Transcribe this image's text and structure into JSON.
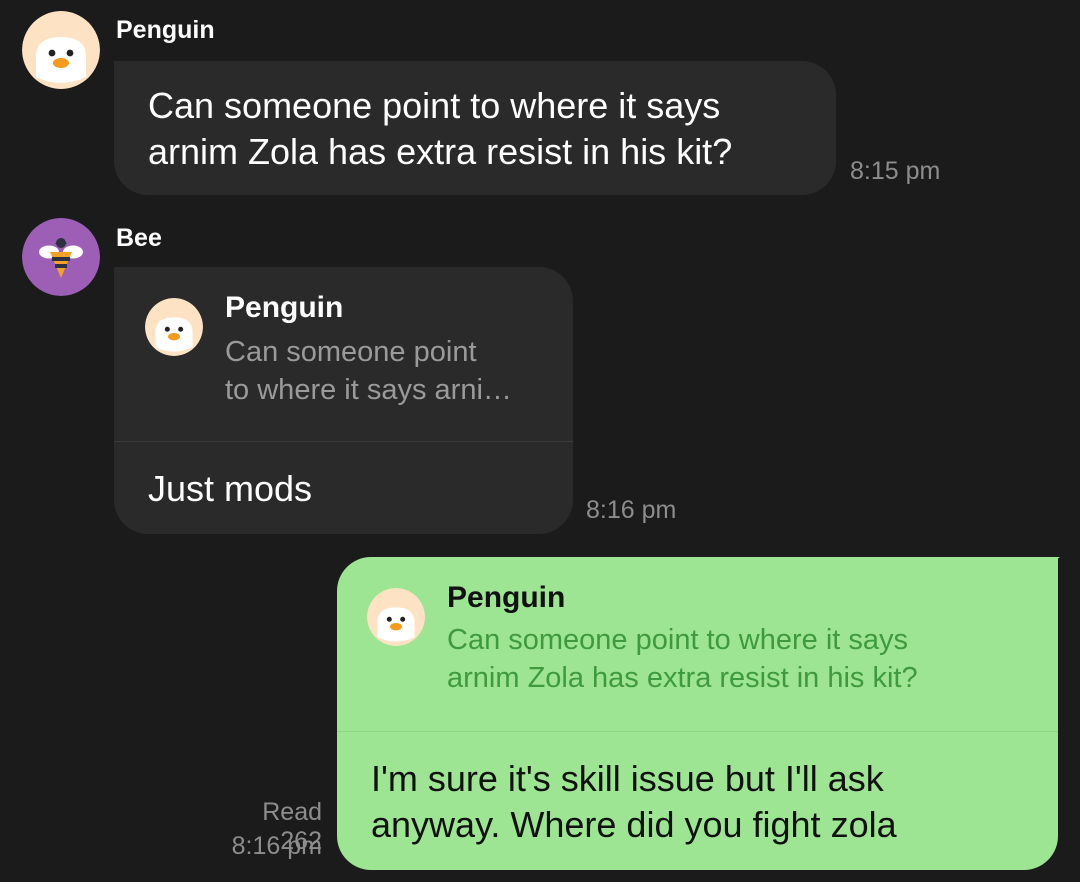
{
  "messages": [
    {
      "sender": "Penguin",
      "text_line1": "Can someone point to where it says",
      "text_line2": "arnim Zola has extra resist in his kit?",
      "time": "8:15 pm",
      "avatar_icon": "penguin-icon"
    },
    {
      "sender": "Bee",
      "avatar_icon": "bee-icon",
      "reply": {
        "name": "Penguin",
        "line1": "Can someone point",
        "line2": "to where it says arni…"
      },
      "text": "Just mods",
      "time": "8:16 pm"
    },
    {
      "reply": {
        "name": "Penguin",
        "line1": "Can someone point to where it says",
        "line2": "arnim Zola has extra resist in his kit?"
      },
      "text_line1": "I'm sure it's skill issue but I'll ask",
      "text_line2": "anyway. Where did you fight zola",
      "read": "Read 262",
      "time": "8:16 pm"
    }
  ],
  "colors": {
    "background": "#1b1b1b",
    "incoming_bubble": "#2a2a2a",
    "outgoing_bubble": "#9de593",
    "quote_text_outgoing": "#3f9a3f",
    "bee_avatar_bg": "#9c5fb5",
    "penguin_avatar_bg": "#fde3c4"
  }
}
